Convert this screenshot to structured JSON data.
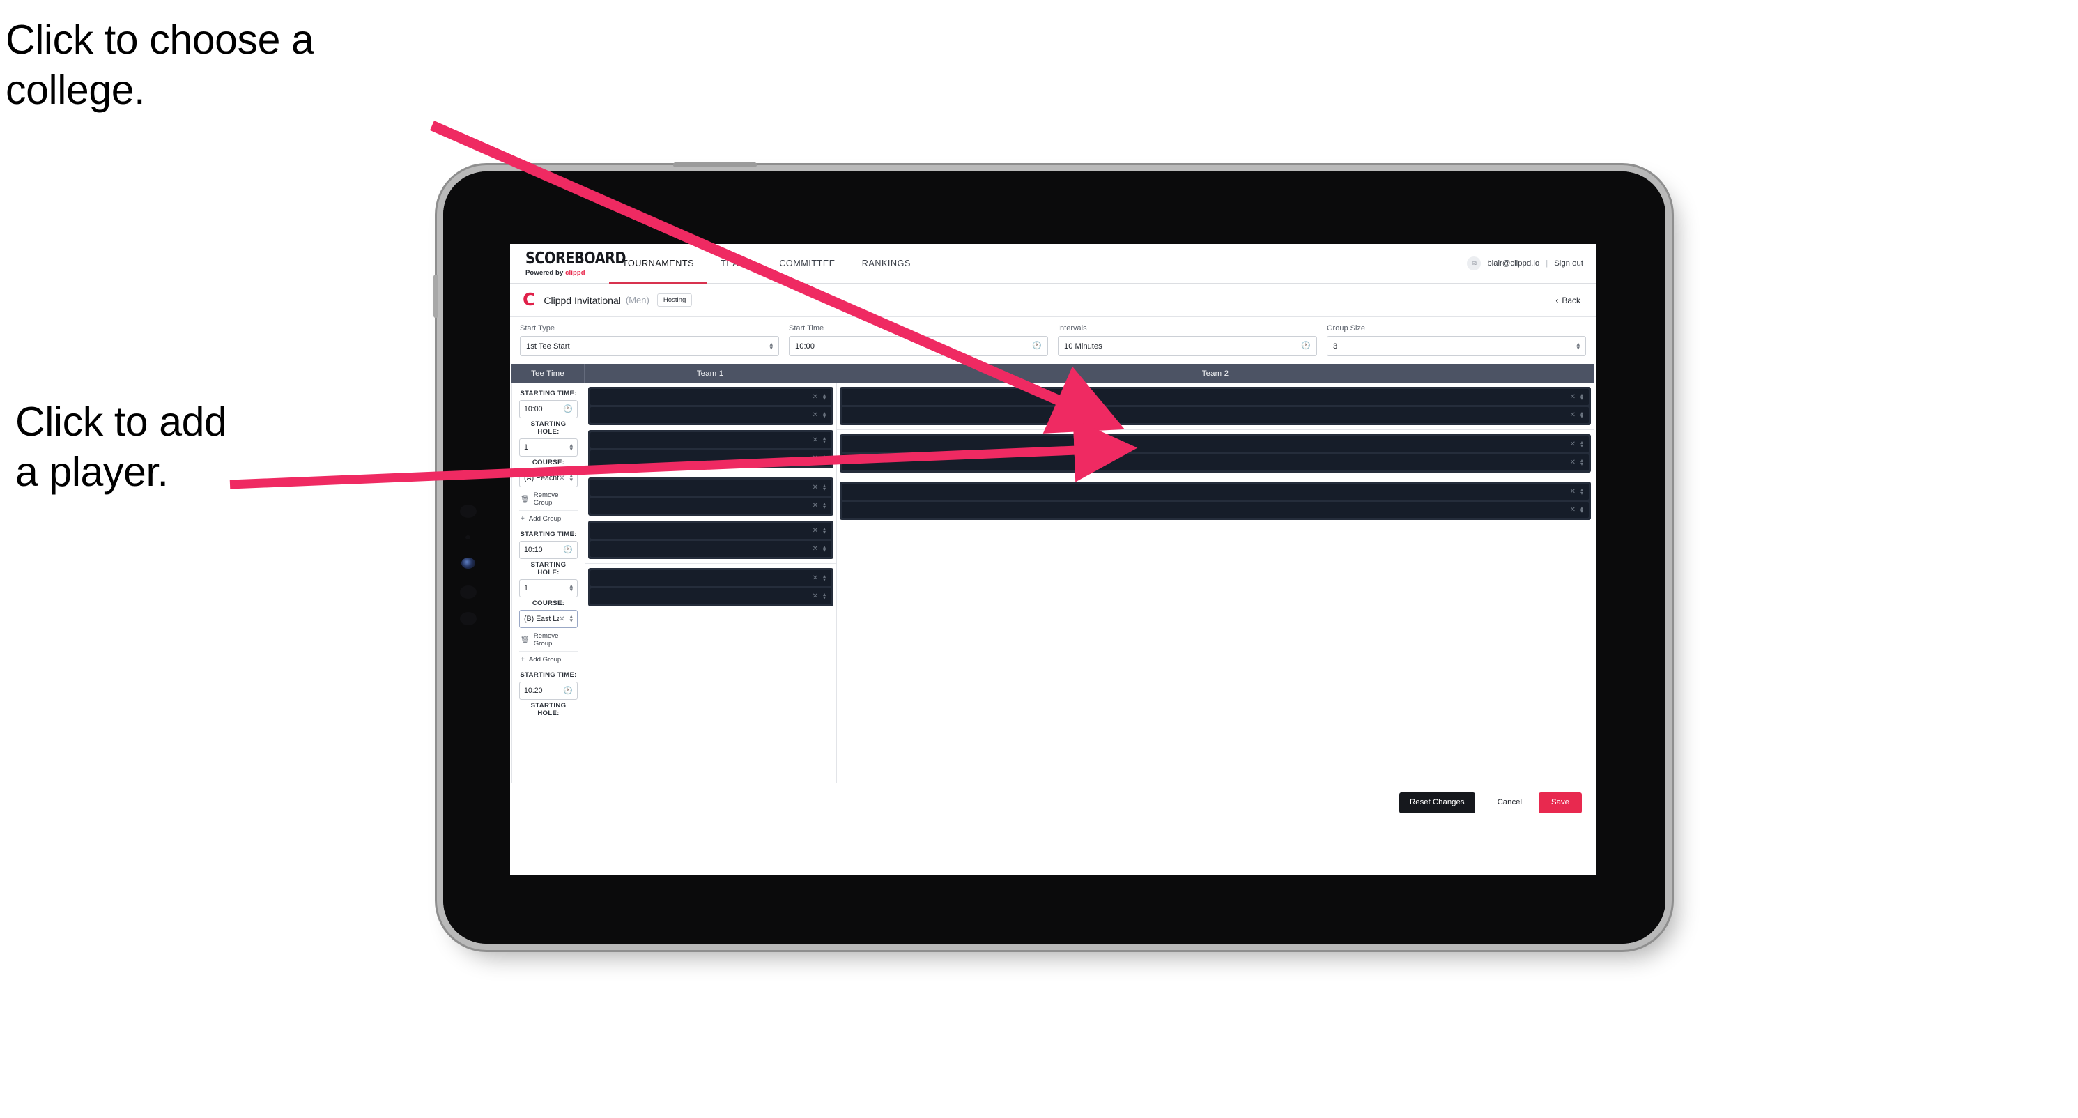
{
  "annotations": {
    "choose_college": "Click to choose a\ncollege.",
    "add_player": "Click to add\na player."
  },
  "colors": {
    "accent_pink": "#e8274b",
    "annotation_arrow": "#ef2a62",
    "header_slate": "#4c5364",
    "dark_row": "#161d29",
    "dark_block": "#252d3b",
    "save_red": "#e8294f",
    "reset_dark": "#16181d"
  },
  "app": {
    "brand": {
      "wordmark": "SCOREBOARD",
      "powered_prefix": "Powered by",
      "powered_name": "clippd"
    },
    "nav_tabs": [
      {
        "label": "TOURNAMENTS",
        "active": true
      },
      {
        "label": "TEAMS",
        "active": false
      },
      {
        "label": "COMMITTEE",
        "active": false
      },
      {
        "label": "RANKINGS",
        "active": false
      }
    ],
    "account": {
      "avatar_glyph": "✉",
      "email": "blair@clippd.io",
      "separator": "|",
      "sign_out": "Sign out"
    },
    "tournament": {
      "logo_letter": "C",
      "name": "Clippd Invitational",
      "gender": "(Men)",
      "role_badge": "Hosting",
      "back_chevron": "‹",
      "back_label": "Back"
    },
    "controls": [
      {
        "label": "Start Type",
        "value": "1st Tee Start",
        "icon": "stepper-icon"
      },
      {
        "label": "Start Time",
        "value": "10:00",
        "icon": "clock-icon"
      },
      {
        "label": "Intervals",
        "value": "10 Minutes",
        "icon": "clock-icon"
      },
      {
        "label": "Group Size",
        "value": "3",
        "icon": "stepper-icon"
      }
    ],
    "table_headers": {
      "tee_time": "Tee Time",
      "team_1": "Team 1",
      "team_2": "Team 2"
    },
    "field_labels": {
      "starting_time": "STARTING TIME:",
      "starting_hole": "STARTING HOLE:",
      "course": "COURSE:"
    },
    "group_actions": {
      "remove": "Remove Group",
      "add": "Add Group",
      "remove_icon": "trash-icon",
      "add_icon": "plus-icon"
    },
    "groups": [
      {
        "starting_time": "10:00",
        "starting_hole": "1",
        "course": "(A) Peachtree GC",
        "course_selected": false,
        "team1_blocks": [
          2,
          2
        ],
        "team2_blocks": [
          2
        ]
      },
      {
        "starting_time": "10:10",
        "starting_hole": "1",
        "course": "(B) East Lake GC",
        "course_selected": true,
        "team1_blocks": [
          2,
          2
        ],
        "team2_blocks": [
          2
        ]
      },
      {
        "starting_time": "10:20",
        "starting_hole": "",
        "course": "",
        "course_selected": false,
        "team1_blocks": [
          2
        ],
        "team2_blocks": [
          2
        ]
      }
    ],
    "footer": {
      "reset": "Reset Changes",
      "cancel": "Cancel",
      "save": "Save"
    }
  }
}
